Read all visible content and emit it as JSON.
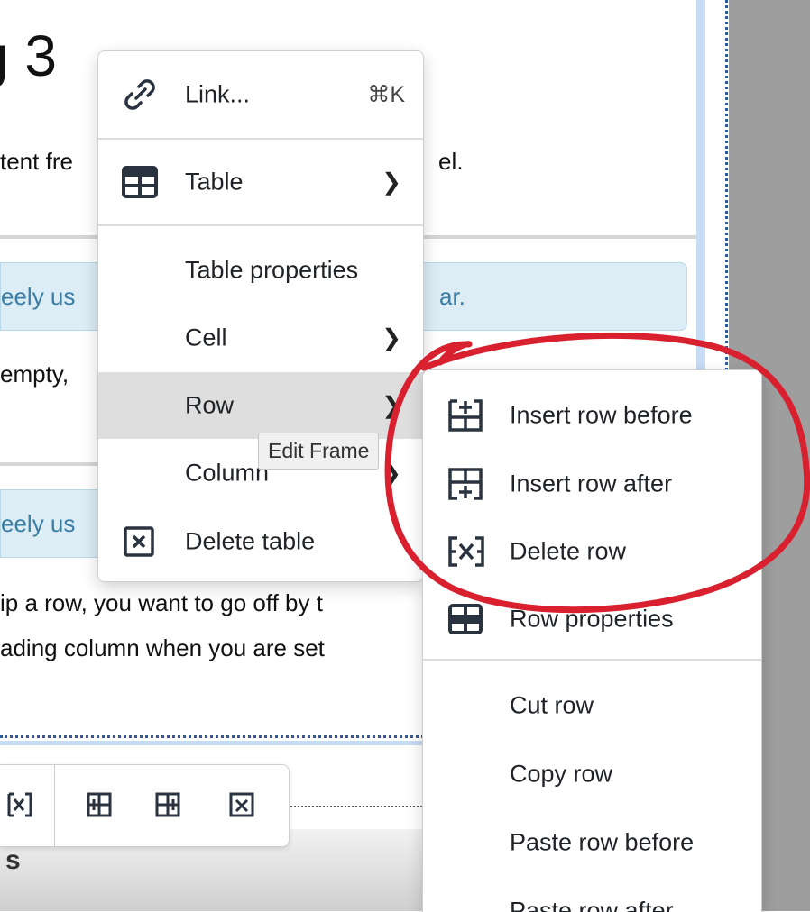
{
  "document": {
    "heading_fragment": "g 3",
    "para1_fragment": "tent fre",
    "para1_fragment_right": "el.",
    "notice1_fragment": "eely us",
    "notice1_fragment_right": "ar.",
    "para2_fragment": "empty, ",
    "notice2_fragment": "eely us",
    "para3_line1": "ip a row, you want to go off by t",
    "para3_line2": "ading column when you are set",
    "bottom_fragment": "s"
  },
  "context_menu": {
    "link": {
      "label": "Link...",
      "shortcut": "⌘K",
      "icon": "link-icon"
    },
    "table": {
      "label": "Table",
      "icon": "table-icon"
    },
    "table_properties": {
      "label": "Table properties"
    },
    "cell": {
      "label": "Cell"
    },
    "row": {
      "label": "Row"
    },
    "column": {
      "label": "Column"
    },
    "delete_table": {
      "label": "Delete table",
      "icon": "delete-table-icon"
    }
  },
  "tooltip": {
    "text": "Edit Frame"
  },
  "row_submenu": {
    "insert_before": {
      "label": "Insert row before",
      "icon": "insert-row-before-icon"
    },
    "insert_after": {
      "label": "Insert row after",
      "icon": "insert-row-after-icon"
    },
    "delete_row": {
      "label": "Delete row",
      "icon": "delete-row-icon"
    },
    "row_properties": {
      "label": "Row properties",
      "icon": "row-properties-icon"
    },
    "cut_row": {
      "label": "Cut row"
    },
    "copy_row": {
      "label": "Copy row"
    },
    "paste_before": {
      "label": "Paste row before"
    },
    "paste_after": {
      "label": "Paste row after"
    }
  },
  "colors": {
    "annotation": "#d9202e",
    "notice_bg": "#dcedf5",
    "notice_text": "#3a7ea6",
    "hover_bg": "#dedede",
    "icon_color": "#2a3340"
  }
}
